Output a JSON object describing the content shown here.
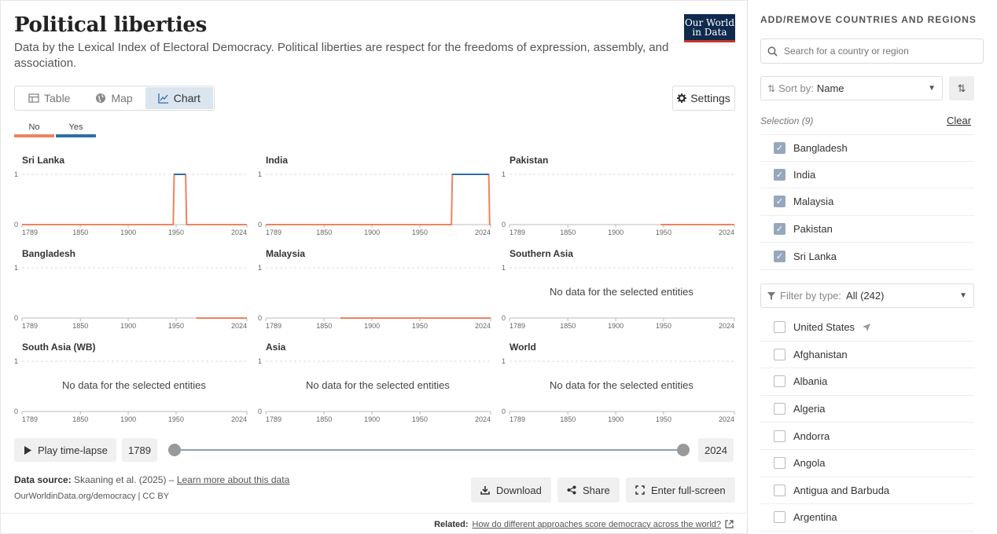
{
  "header": {
    "title": "Political liberties",
    "subtitle": "Data by the Lexical Index of Electoral Democracy. Political liberties are respect for the freedoms of expression, assembly, and association.",
    "logo_line1": "Our World",
    "logo_line2": "in Data"
  },
  "tabs": [
    {
      "label": "Table",
      "icon": "table-icon"
    },
    {
      "label": "Map",
      "icon": "globe-icon"
    },
    {
      "label": "Chart",
      "icon": "line-chart-icon"
    }
  ],
  "settings_label": "Settings",
  "legend": [
    {
      "label": "No",
      "color": "#f0825f"
    },
    {
      "label": "Yes",
      "color": "#2c6ea8"
    }
  ],
  "chart_data": {
    "type": "line",
    "layout": "small-multiples",
    "x_ticks": [
      "1789",
      "1850",
      "1900",
      "1950",
      "2024"
    ],
    "y_ticks": [
      "0",
      "1"
    ],
    "xlim": [
      1789,
      2024
    ],
    "ylim": [
      0,
      1
    ],
    "no_data_text": "No data for the selected entities",
    "facets": [
      {
        "title": "Sri Lanka",
        "has_data": true,
        "series": [
          {
            "name": "No",
            "points": [
              [
                1789,
                0
              ],
              [
                1947,
                0
              ],
              [
                1948,
                1
              ],
              [
                1960,
                1
              ],
              [
                1961,
                0
              ],
              [
                2024,
                0
              ]
            ]
          },
          {
            "name": "Yes",
            "points": [
              [
                1948,
                1
              ],
              [
                1960,
                1
              ]
            ]
          }
        ]
      },
      {
        "title": "India",
        "has_data": true,
        "series": [
          {
            "name": "No",
            "points": [
              [
                1789,
                0
              ],
              [
                1983,
                0
              ],
              [
                1984,
                1
              ],
              [
                2022,
                1
              ],
              [
                2023,
                0
              ],
              [
                2024,
                0
              ]
            ]
          },
          {
            "name": "Yes",
            "points": [
              [
                1984,
                1
              ],
              [
                2022,
                1
              ]
            ]
          }
        ]
      },
      {
        "title": "Pakistan",
        "has_data": true,
        "series": [
          {
            "name": "No",
            "points": [
              [
                1947,
                0
              ],
              [
                2024,
                0
              ]
            ]
          }
        ]
      },
      {
        "title": "Bangladesh",
        "has_data": true,
        "series": [
          {
            "name": "No",
            "points": [
              [
                1971,
                0
              ],
              [
                2024,
                0
              ]
            ]
          }
        ]
      },
      {
        "title": "Malaysia",
        "has_data": true,
        "series": [
          {
            "name": "No",
            "points": [
              [
                1867,
                0
              ],
              [
                2024,
                0
              ]
            ]
          }
        ]
      },
      {
        "title": "Southern Asia",
        "has_data": false,
        "series": []
      },
      {
        "title": "South Asia (WB)",
        "has_data": false,
        "series": []
      },
      {
        "title": "Asia",
        "has_data": false,
        "series": []
      },
      {
        "title": "World",
        "has_data": false,
        "series": []
      }
    ]
  },
  "timeline": {
    "play_label": "Play time-lapse",
    "start_year": "1789",
    "end_year": "2024"
  },
  "footer": {
    "source_label": "Data source:",
    "source_text": "Skaaning et al. (2025) –",
    "learn_more": "Learn more about this data",
    "url": "OurWorldinData.org/democracy | CC BY",
    "download": "Download",
    "share": "Share",
    "fullscreen": "Enter full-screen",
    "related_label": "Related:",
    "related_link": "How do different approaches score democracy across the world?"
  },
  "sidebar": {
    "header": "ADD/REMOVE COUNTRIES AND REGIONS",
    "search_placeholder": "Search for a country or region",
    "sort_label": "Sort by:",
    "sort_value": "Name",
    "selection_label": "Selection (9)",
    "clear_label": "Clear",
    "selected": [
      "Bangladesh",
      "India",
      "Malaysia",
      "Pakistan",
      "Sri Lanka"
    ],
    "filter_label": "Filter by type:",
    "filter_value": "All (242)",
    "available": [
      "United States",
      "Afghanistan",
      "Albania",
      "Algeria",
      "Andorra",
      "Angola",
      "Antigua and Barbuda",
      "Argentina"
    ]
  }
}
